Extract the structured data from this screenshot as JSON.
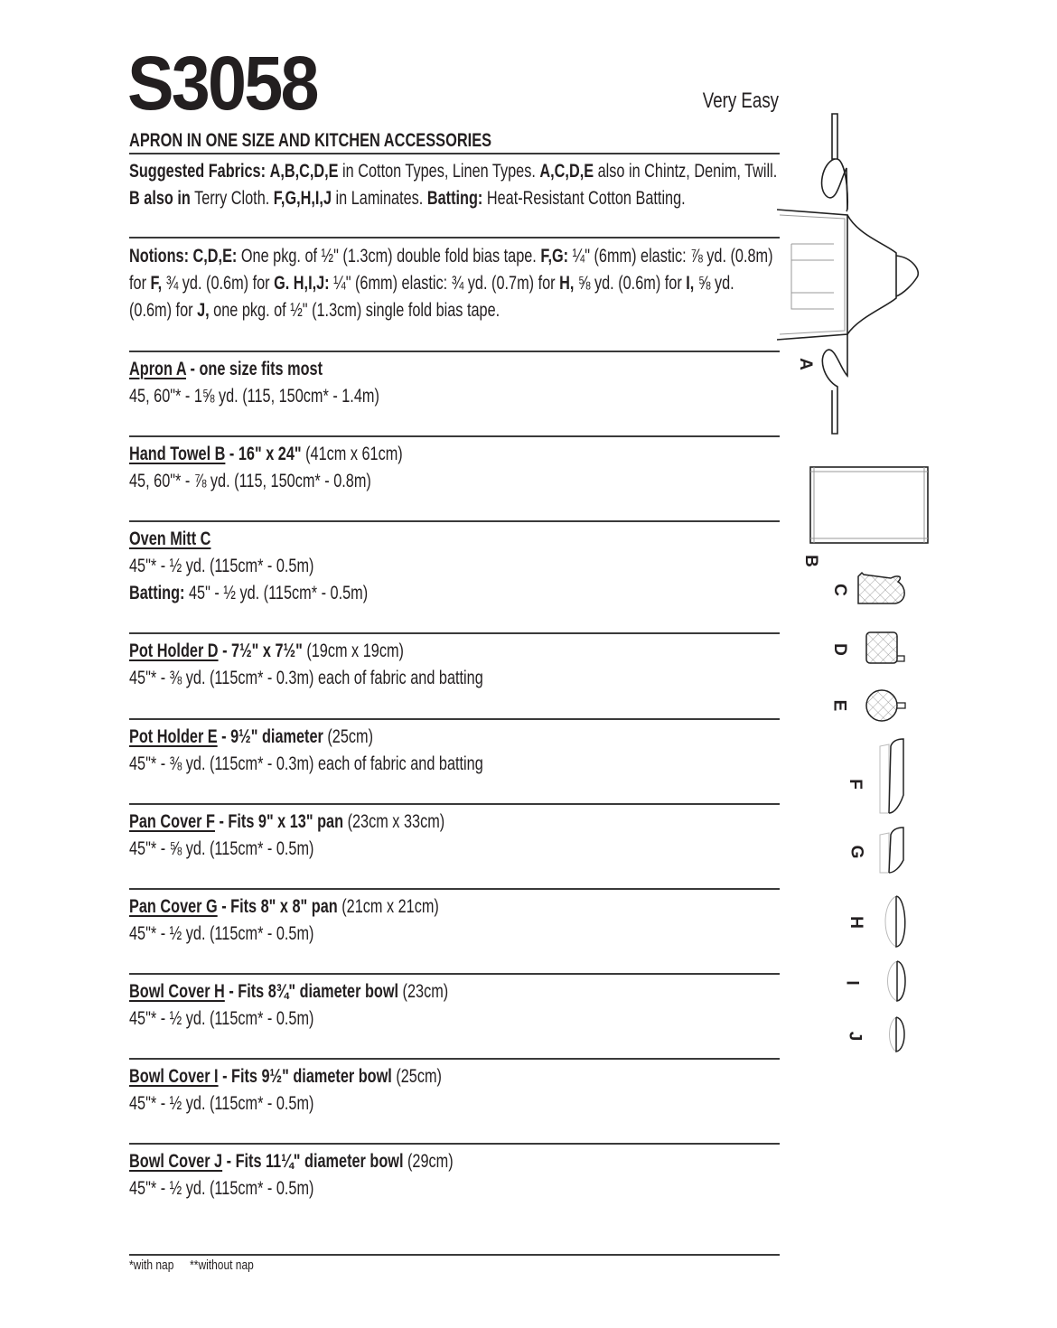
{
  "header": {
    "pattern_number": "S3058",
    "difficulty": "Very Easy",
    "title": "APRON IN ONE SIZE AND KITCHEN ACCESSORIES"
  },
  "suggested_fabrics": {
    "label": "Suggested Fabrics:",
    "parts": [
      {
        "b": "A,B,C,D,E",
        "t": " in Cotton Types, Linen Types. "
      },
      {
        "b": "A,C,D,E",
        "t": " also in Chintz, Denim, Twill. "
      },
      {
        "b": "B also in",
        "t": " Terry Cloth. "
      },
      {
        "b": "F,G,H,I,J",
        "t": " in Laminates. "
      },
      {
        "b": "Batting:",
        "t": " Heat-Resistant Cotton Batting."
      }
    ]
  },
  "notions": {
    "label": "Notions:",
    "parts": [
      {
        "b": "C,D,E:",
        "t": " One pkg. of ½\" (1.3cm) double fold bias tape. "
      },
      {
        "b": "F,G:",
        "t": " ¼\" (6mm) elastic: ⅞ yd. (0.8m) for "
      },
      {
        "b": "F,",
        "t": " ¾ yd. (0.6m) for "
      },
      {
        "b": "G. H,I,J:",
        "t": " ¼\" (6mm) elastic: ¾ yd. (0.7m) for "
      },
      {
        "b": "H,",
        "t": " ⅝ yd. (0.6m) for "
      },
      {
        "b": "I,",
        "t": " ⅝ yd. (0.6m) for "
      },
      {
        "b": "J,",
        "t": " one pkg. of ½\" (1.3cm) single fold bias tape."
      }
    ]
  },
  "views": [
    {
      "name": "Apron A",
      "spec": " - one size fits most",
      "metric": "",
      "lines": [
        "45, 60\"* - 1⅝ yd. (115, 150cm* - 1.4m)"
      ]
    },
    {
      "name": "Hand Towel B",
      "spec": " - 16\" x 24\"",
      "metric": " (41cm x 61cm)",
      "lines": [
        "45, 60\"* - ⅞ yd. (115, 150cm* - 0.8m)"
      ]
    },
    {
      "name": "Oven Mitt C",
      "spec": "",
      "metric": "",
      "lines": [
        "45\"* - ½ yd. (115cm* - 0.5m)"
      ],
      "batting": {
        "label": "Batting:",
        "text": " 45\" - ½ yd. (115cm* - 0.5m)"
      }
    },
    {
      "name": "Pot Holder D",
      "spec": " - 7½\" x 7½\"",
      "metric": " (19cm x 19cm)",
      "lines": [
        "45\"* - ⅜ yd. (115cm* - 0.3m) each of fabric and batting"
      ]
    },
    {
      "name": "Pot Holder E",
      "spec": " - 9½\" diameter",
      "metric": " (25cm)",
      "lines": [
        "45\"* - ⅜ yd. (115cm* - 0.3m) each of fabric and batting"
      ]
    },
    {
      "name": "Pan Cover F",
      "spec": " - Fits 9\" x 13\" pan",
      "metric": " (23cm x 33cm)",
      "lines": [
        "45\"* - ⅝  yd. (115cm* - 0.5m)"
      ]
    },
    {
      "name": "Pan Cover G",
      "spec": " - Fits 8\" x 8\" pan",
      "metric": " (21cm x 21cm)",
      "lines": [
        "45\"* - ½ yd. (115cm* - 0.5m)"
      ]
    },
    {
      "name": "Bowl Cover H",
      "spec": " - Fits 8¾\" diameter bowl",
      "metric": " (23cm)",
      "lines": [
        "45\"* - ½ yd. (115cm* - 0.5m)"
      ]
    },
    {
      "name": "Bowl Cover I",
      "spec": " - Fits 9½\" diameter bowl",
      "metric": " (25cm)",
      "lines": [
        "45\"* - ½ yd. (115cm* - 0.5m)"
      ]
    },
    {
      "name": "Bowl Cover J",
      "spec": " - Fits 11¼\" diameter bowl",
      "metric": " (29cm)",
      "lines": [
        "45\"* - ½ yd. (115cm* - 0.5m)"
      ]
    }
  ],
  "footnote": {
    "with_nap": "*with nap",
    "without_nap": "**without nap"
  },
  "illustration_labels": [
    "A",
    "B",
    "C",
    "D",
    "E",
    "F",
    "G",
    "H",
    "I",
    "J"
  ]
}
